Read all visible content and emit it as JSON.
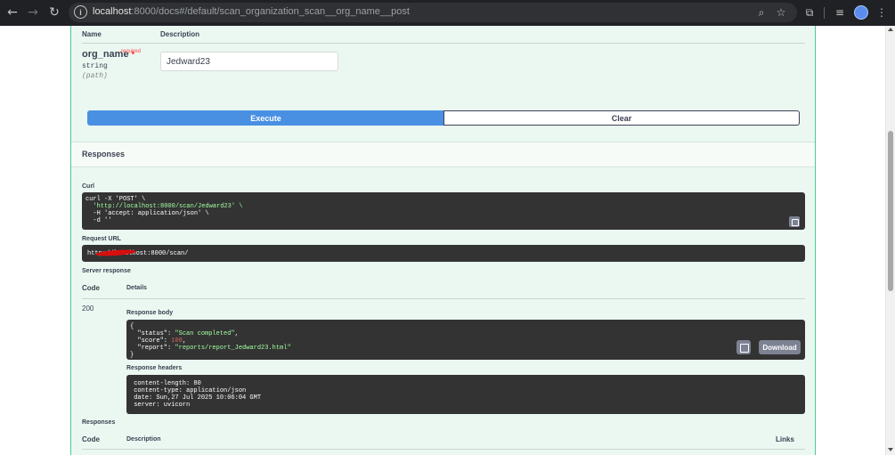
{
  "browser": {
    "url_host": "localhost",
    "url_path": ":8000/docs#/default/scan_organization_scan__org_name__post",
    "icons": [
      "back-icon",
      "forward-icon",
      "reload-icon",
      "site-info-icon",
      "zoom-icon",
      "star-icon",
      "extensions-icon",
      "media-icon",
      "menu-icon"
    ]
  },
  "params": {
    "col_name": "Name",
    "col_description": "Description",
    "name": "org_name",
    "required_star": "*",
    "required_label": "required",
    "type": "string",
    "in": "(path)",
    "value": "Jedward23"
  },
  "actions": {
    "execute": "Execute",
    "clear": "Clear"
  },
  "responses": {
    "title": "Responses",
    "curl_label": "Curl",
    "curl_lines": [
      "curl -X 'POST' \\",
      "  'http://localhost:8000/scan/Jedward23' \\",
      "  -H 'accept: application/json' \\",
      "  -d ''"
    ],
    "request_url_label": "Request URL",
    "request_url": "http://localhost:8000/scan/",
    "server_response_label": "Server response",
    "code_header": "Code",
    "details_header": "Details",
    "code": "200",
    "body_label": "Response body",
    "body": {
      "open": "{",
      "status_key": "  \"status\": ",
      "status_val": "\"Scan completed\"",
      "score_key": "  \"score\": ",
      "score_val": "100",
      "report_key": "  \"report\": ",
      "report_val": "\"reports/report_Jedward23.html\"",
      "close": "}"
    },
    "download": "Download",
    "headers_label": "Response headers",
    "headers_lines": [
      " content-length: 80",
      " content-type: application/json",
      " date: Sun,27 Jul 2025 10:06:04 GMT",
      " server: uvicorn"
    ]
  },
  "responses_section": {
    "title": "Responses",
    "code_header": "Code",
    "description_header": "Description",
    "links_header": "Links"
  }
}
